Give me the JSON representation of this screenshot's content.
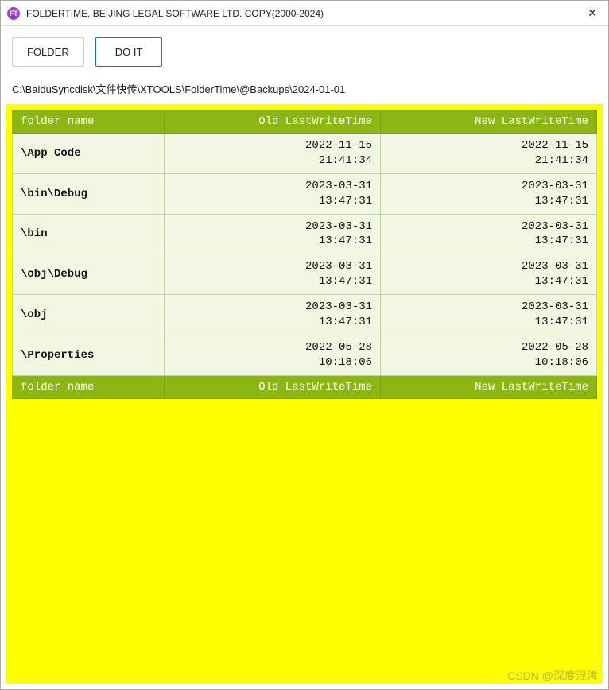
{
  "window": {
    "app_icon_text": "FT",
    "title": "FOLDERTIME, BEIJING LEGAL SOFTWARE LTD. COPY(2000-2024)",
    "close_symbol": "✕"
  },
  "toolbar": {
    "folder_label": "FOLDER",
    "doit_label": "DO IT"
  },
  "path": "C:\\BaiduSyncdisk\\文件快传\\XTOOLS\\FolderTime\\@Backups\\2024-01-01",
  "table": {
    "headers": {
      "folder": "folder name",
      "old": "Old LastWriteTime",
      "new": "New LastWriteTime"
    },
    "rows": [
      {
        "folder": "\\App_Code",
        "old": "2022-11-15\n21:41:34",
        "new": "2022-11-15\n21:41:34"
      },
      {
        "folder": "\\bin\\Debug",
        "old": "2023-03-31\n13:47:31",
        "new": "2023-03-31\n13:47:31"
      },
      {
        "folder": "\\bin",
        "old": "2023-03-31\n13:47:31",
        "new": "2023-03-31\n13:47:31"
      },
      {
        "folder": "\\obj\\Debug",
        "old": "2023-03-31\n13:47:31",
        "new": "2023-03-31\n13:47:31"
      },
      {
        "folder": "\\obj",
        "old": "2023-03-31\n13:47:31",
        "new": "2023-03-31\n13:47:31"
      },
      {
        "folder": "\\Properties",
        "old": "2022-05-28\n10:18:06",
        "new": "2022-05-28\n10:18:06"
      }
    ],
    "footers": {
      "folder": "folder name",
      "old": "Old LastWriteTime",
      "new": "New LastWriteTime"
    }
  },
  "watermark": "CSDN @深度混淆"
}
